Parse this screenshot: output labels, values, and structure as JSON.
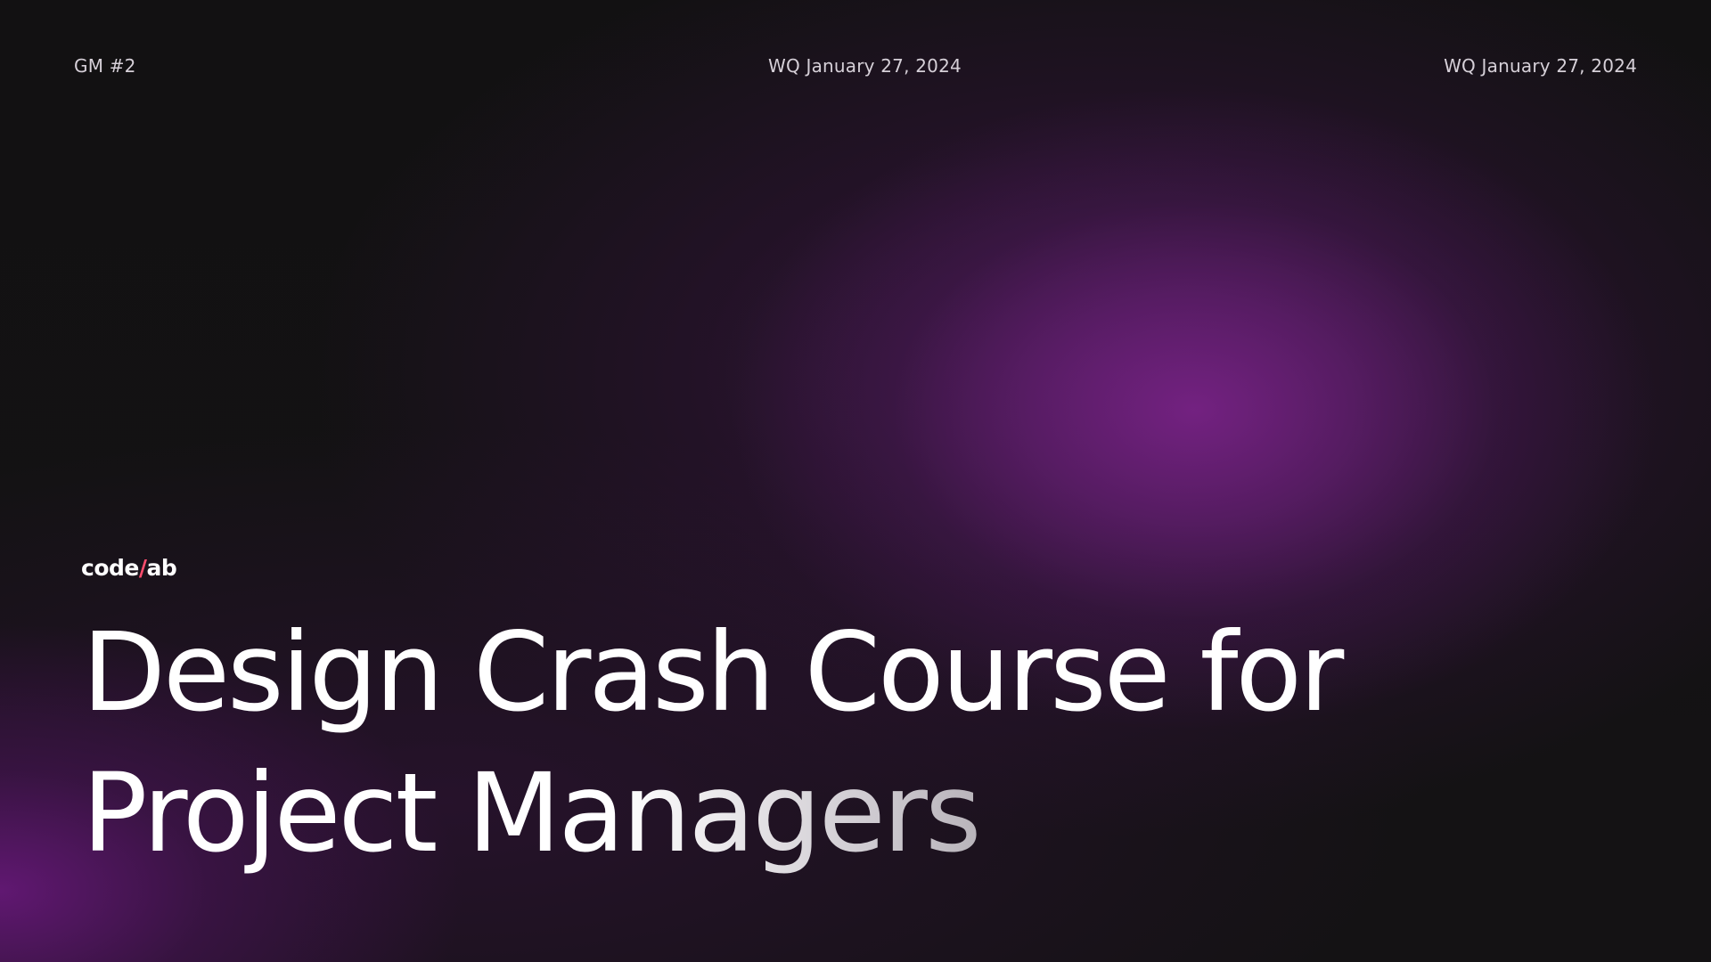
{
  "header": {
    "left_label": "GM #2",
    "center_label": "WQ January 27, 2024",
    "right_label": "WQ January 27, 2024"
  },
  "brand": {
    "part1": "code",
    "accent": "/",
    "part2": "ab"
  },
  "headline": {
    "line1": "Design Crash Course for",
    "line2": "Project Managers"
  },
  "colors": {
    "background": "#111111",
    "glow_purple": "#762284",
    "brand_accent": "#ff4d6d",
    "headline_text": "#ffffff"
  }
}
